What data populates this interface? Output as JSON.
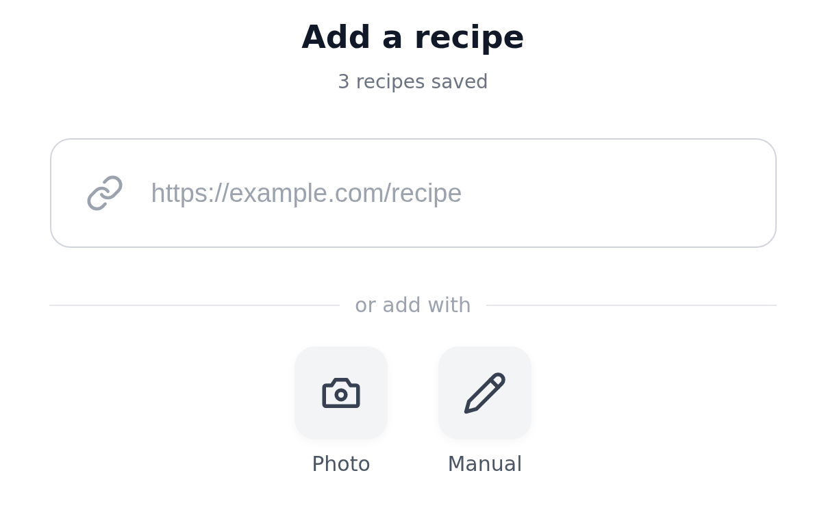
{
  "title": "Add a recipe",
  "subtitle": "3 recipes saved",
  "url_field": {
    "placeholder": "https://example.com/recipe"
  },
  "divider_label": "or add with",
  "options": [
    {
      "kind": "photo",
      "label": "Photo"
    },
    {
      "kind": "manual",
      "label": "Manual"
    }
  ]
}
